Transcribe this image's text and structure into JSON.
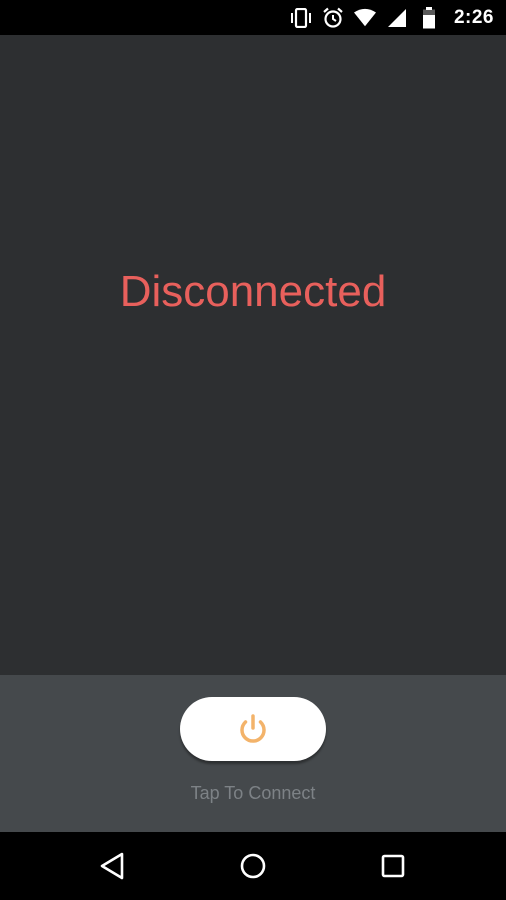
{
  "status_bar": {
    "time": "2:26",
    "icons": [
      "vibrate-icon",
      "alarm-icon",
      "wifi-icon",
      "signal-icon",
      "battery-icon"
    ]
  },
  "main": {
    "connection_status": "Disconnected",
    "status_color": "#e8605c"
  },
  "connect_panel": {
    "button_icon": "power-icon",
    "button_icon_color": "#f3b36a",
    "label": "Tap To Connect"
  },
  "nav_bar": {
    "buttons": [
      "back-icon",
      "home-icon",
      "recents-icon"
    ]
  }
}
